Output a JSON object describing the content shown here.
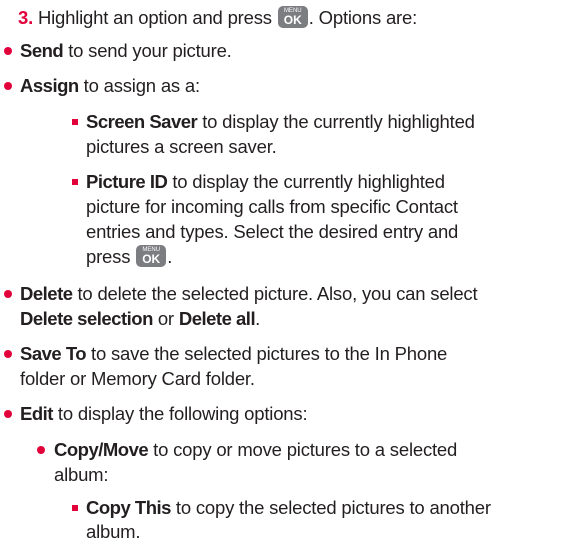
{
  "colors": {
    "accent": "#e2003b",
    "text": "#231f20",
    "key_bg": "#7c7d80"
  },
  "key_icon": {
    "top": "MENU",
    "label": "OK"
  },
  "step": {
    "number": "3.",
    "text_a": "Highlight an option and press",
    "text_b": ". Options are:"
  },
  "items": {
    "send": {
      "term": "Send",
      "desc": "to send your picture."
    },
    "assign": {
      "term": "Assign",
      "desc": "to assign as a:"
    },
    "screen_saver": {
      "term": "Screen Saver",
      "desc": "to display the currently highlighted",
      "cont1": "pictures a screen saver."
    },
    "picture_id": {
      "term": "Picture ID",
      "desc": "to display the currently highlighted",
      "cont1": "picture for incoming calls from specific Contact",
      "cont2": "entries and types. Select the desired entry and",
      "cont3_a": "press",
      "cont3_b": "."
    },
    "delete": {
      "term": "Delete",
      "desc": "to delete the selected picture. Also, you can select",
      "cont_term1": "Delete selection",
      "cont_or": "or",
      "cont_term2": "Delete all",
      "cont_end": "."
    },
    "save_to": {
      "term": "Save To",
      "desc": "to save the selected pictures to the In Phone",
      "cont1": "folder or Memory Card folder."
    },
    "edit": {
      "term": "Edit",
      "desc": "to display the following options:"
    },
    "copy_move": {
      "term": "Copy/Move",
      "desc": "to copy or move pictures to a selected",
      "cont1": "album:"
    },
    "copy_this": {
      "term": "Copy This",
      "desc": "to copy the selected pictures to another",
      "cont1": "album."
    }
  }
}
